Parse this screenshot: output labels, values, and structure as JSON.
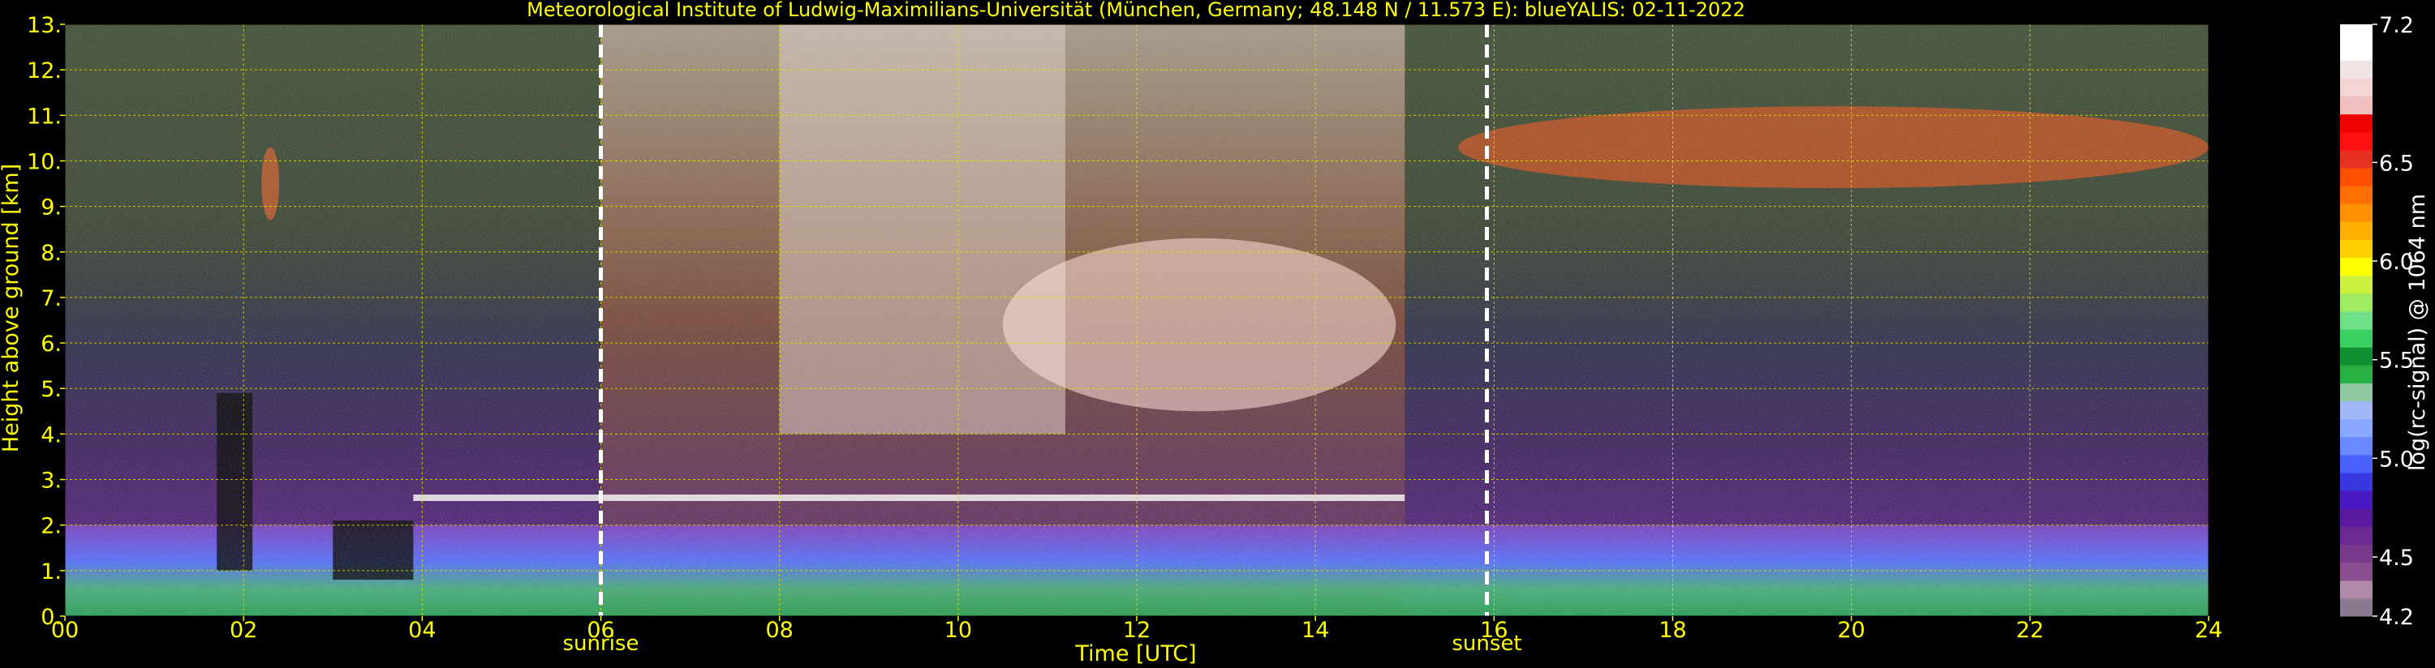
{
  "chart_data": {
    "type": "heatmap",
    "title": "Meteorological Institute of Ludwig-Maximilians-Universität (München, Germany; 48.148 N / 11.573 E):     blueYALIS: 02-11-2022",
    "xlabel": "Time [UTC]",
    "ylabel": "Height above ground [km]",
    "xlim": [
      0,
      24
    ],
    "ylim": [
      0,
      13
    ],
    "x_ticks": [
      {
        "value": 0,
        "label": "00"
      },
      {
        "value": 2,
        "label": "02"
      },
      {
        "value": 4,
        "label": "04"
      },
      {
        "value": 6,
        "label": "06"
      },
      {
        "value": 8,
        "label": "08"
      },
      {
        "value": 10,
        "label": "10"
      },
      {
        "value": 12,
        "label": "12"
      },
      {
        "value": 14,
        "label": "14"
      },
      {
        "value": 16,
        "label": "16"
      },
      {
        "value": 18,
        "label": "18"
      },
      {
        "value": 20,
        "label": "20"
      },
      {
        "value": 22,
        "label": "22"
      },
      {
        "value": 24,
        "label": "24"
      }
    ],
    "y_ticks": [
      {
        "value": 0,
        "label": "0."
      },
      {
        "value": 1,
        "label": "1."
      },
      {
        "value": 2,
        "label": "2."
      },
      {
        "value": 3,
        "label": "3."
      },
      {
        "value": 4,
        "label": "4."
      },
      {
        "value": 5,
        "label": "5."
      },
      {
        "value": 6,
        "label": "6."
      },
      {
        "value": 7,
        "label": "7."
      },
      {
        "value": 8,
        "label": "8."
      },
      {
        "value": 9,
        "label": "9."
      },
      {
        "value": 10,
        "label": "10."
      },
      {
        "value": 11,
        "label": "11."
      },
      {
        "value": 12,
        "label": "12."
      },
      {
        "value": 13,
        "label": "13."
      }
    ],
    "grid": true,
    "events": [
      {
        "label": "sunrise",
        "time": 6.0
      },
      {
        "label": "sunset",
        "time": 15.92
      }
    ],
    "colorbar": {
      "label": "log(rc-signal) @ 1064 nm",
      "range": [
        4.2,
        7.2
      ],
      "ticks": [
        {
          "value": 4.2,
          "label": "4.2"
        },
        {
          "value": 4.5,
          "label": "4.5"
        },
        {
          "value": 5.0,
          "label": "5.0"
        },
        {
          "value": 5.5,
          "label": "5.5"
        },
        {
          "value": 6.0,
          "label": "6.0"
        },
        {
          "value": 6.5,
          "label": "6.5"
        },
        {
          "value": 7.2,
          "label": "7.2"
        }
      ],
      "colors": [
        "#8a7a90",
        "#b08aa8",
        "#8a4f90",
        "#7a3a8c",
        "#6a2a90",
        "#5a1aa0",
        "#4a18c0",
        "#3838e0",
        "#4a60ff",
        "#6a88ff",
        "#8aa8ff",
        "#a0b8f8",
        "#90c8a0",
        "#28b040",
        "#109030",
        "#38d060",
        "#70e088",
        "#a0ec60",
        "#ccf040",
        "#ffff00",
        "#ffd000",
        "#ffb000",
        "#ff9000",
        "#ff7000",
        "#ff5000",
        "#e83020",
        "#ff1010",
        "#ee0000",
        "#f0c0c0",
        "#f4d4d4",
        "#f0e4e4",
        "#ffffff",
        "#ffffff"
      ]
    },
    "features": [
      {
        "name": "boundary layer aerosol",
        "time_range": [
          0,
          24
        ],
        "height_range": [
          0,
          2.0
        ]
      },
      {
        "name": "residual layer top",
        "time_range": [
          3.9,
          15.0
        ],
        "height_km": 2.6
      },
      {
        "name": "cirrus (night)",
        "time_range": [
          2.2,
          2.4
        ],
        "height_range": [
          8.7,
          10.3
        ]
      },
      {
        "name": "cirrus (daytime)",
        "time_range": [
          10.5,
          14.9
        ],
        "height_range": [
          4.5,
          8.3
        ]
      },
      {
        "name": "cirrus (evening)",
        "time_range": [
          15.6,
          24.0
        ],
        "height_range": [
          9.4,
          11.2
        ]
      }
    ]
  }
}
